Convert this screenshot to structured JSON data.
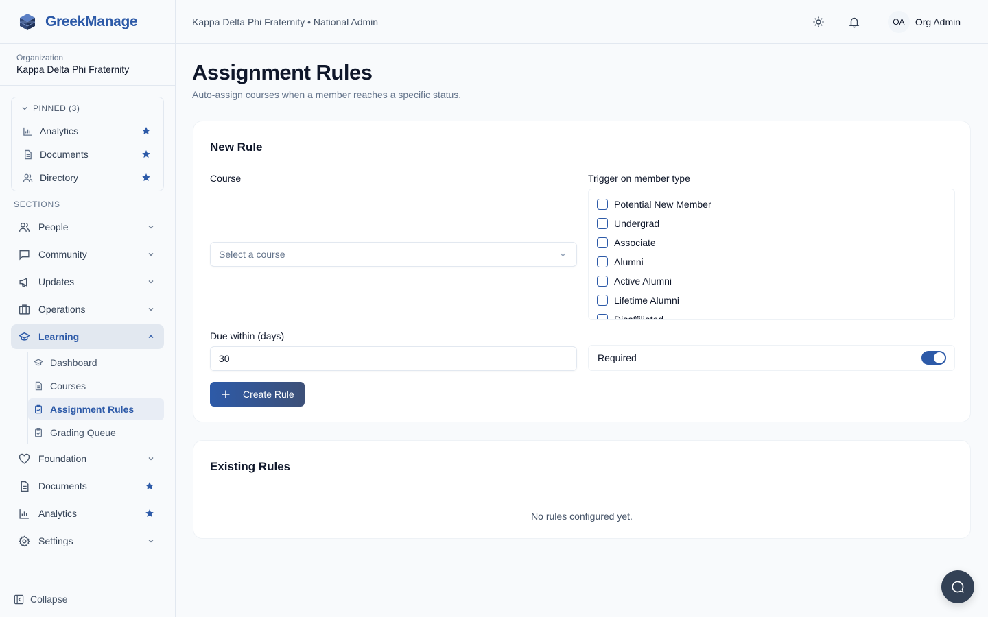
{
  "brand": {
    "name": "GreekManage"
  },
  "org": {
    "label": "Organization",
    "name": "Kappa Delta Phi Fraternity"
  },
  "pinned": {
    "header": "PINNED (3)",
    "items": [
      {
        "label": "Analytics",
        "icon": "bar-chart-icon"
      },
      {
        "label": "Documents",
        "icon": "document-icon"
      },
      {
        "label": "Directory",
        "icon": "users-icon"
      }
    ]
  },
  "sections_label": "SECTIONS",
  "nav": {
    "people": "People",
    "community": "Community",
    "updates": "Updates",
    "operations": "Operations",
    "learning": "Learning",
    "learning_sub": [
      "Dashboard",
      "Courses",
      "Assignment Rules",
      "Grading Queue"
    ],
    "foundation": "Foundation",
    "documents": "Documents",
    "analytics": "Analytics",
    "settings": "Settings"
  },
  "collapse_label": "Collapse",
  "topbar": {
    "breadcrumb": "Kappa Delta Phi Fraternity • National Admin",
    "avatar_initials": "OA",
    "user_name": "Org Admin"
  },
  "page": {
    "title": "Assignment Rules",
    "subtitle": "Auto-assign courses when a member reaches a specific status."
  },
  "new_rule": {
    "title": "New Rule",
    "course_label": "Course",
    "course_placeholder": "Select a course",
    "trigger_label": "Trigger on member type",
    "member_types": [
      "Potential New Member",
      "Undergrad",
      "Associate",
      "Alumni",
      "Active Alumni",
      "Lifetime Alumni",
      "Disaffiliated"
    ],
    "due_label": "Due within (days)",
    "due_value": "30",
    "required_label": "Required",
    "required_on": true,
    "create_button": "Create Rule"
  },
  "existing": {
    "title": "Existing Rules",
    "empty_text": "No rules configured yet."
  },
  "colors": {
    "accent": "#2d5aa8",
    "dark": "#334155"
  }
}
